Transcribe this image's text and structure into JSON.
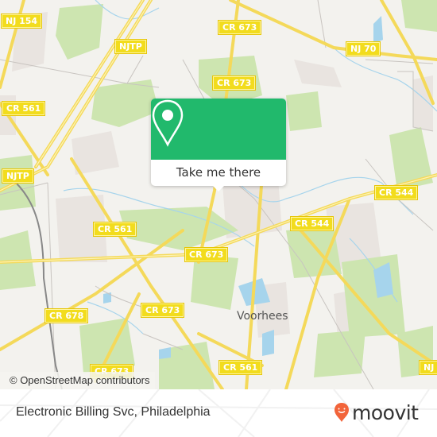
{
  "map": {
    "road_labels": [
      {
        "id": "nj154",
        "text": "NJ 154"
      },
      {
        "id": "njtp-top",
        "text": "NJTP"
      },
      {
        "id": "cr561-left",
        "text": "CR 561"
      },
      {
        "id": "cr673-top",
        "text": "CR 673"
      },
      {
        "id": "cr673-upper",
        "text": "CR 673"
      },
      {
        "id": "nj70",
        "text": "NJ 70"
      },
      {
        "id": "njtp-left",
        "text": "NJTP"
      },
      {
        "id": "cr561-mid",
        "text": "CR 561"
      },
      {
        "id": "cr673-mid",
        "text": "CR 673"
      },
      {
        "id": "cr544-mid",
        "text": "CR 544"
      },
      {
        "id": "cr544-right",
        "text": "CR 544"
      },
      {
        "id": "cr678",
        "text": "CR 678"
      },
      {
        "id": "cr673-lower",
        "text": "CR 673"
      },
      {
        "id": "cr673-bottom",
        "text": "CR 673"
      },
      {
        "id": "cr561-bottom",
        "text": "CR 561"
      },
      {
        "id": "nj-right",
        "text": "NJ"
      }
    ],
    "place_labels": [
      {
        "text": "Voorhees"
      }
    ],
    "attribution": "© OpenStreetMap contributors"
  },
  "popup": {
    "button_label": "Take me there",
    "accent_color": "#21b96c"
  },
  "footer": {
    "title": "Electronic Billing Svc, Philadelphia",
    "logo_text": "moovit",
    "logo_color": "#f2643a"
  }
}
